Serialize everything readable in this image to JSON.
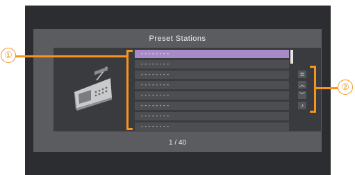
{
  "header": {
    "title": "Preset Stations"
  },
  "stations": [
    {
      "label": "--------"
    },
    {
      "label": "--------"
    },
    {
      "label": "--------"
    },
    {
      "label": "--------"
    },
    {
      "label": "--------"
    },
    {
      "label": "--------"
    },
    {
      "label": "--------"
    },
    {
      "label": "--------"
    }
  ],
  "selected_index": 0,
  "scroll": {
    "position_fraction": 0.0
  },
  "controls": [
    {
      "icon": "list-icon",
      "glyph": "≣"
    },
    {
      "icon": "chevron-up-icon",
      "glyph": "︿"
    },
    {
      "icon": "chevron-down-icon",
      "glyph": "﹀"
    },
    {
      "icon": "music-note-icon",
      "glyph": "♪"
    }
  ],
  "pagination": {
    "text": "1 / 40"
  },
  "callouts": {
    "one": "①",
    "two": "②"
  },
  "colors": {
    "accent": "#a88ac6",
    "callout": "#f7941d"
  }
}
